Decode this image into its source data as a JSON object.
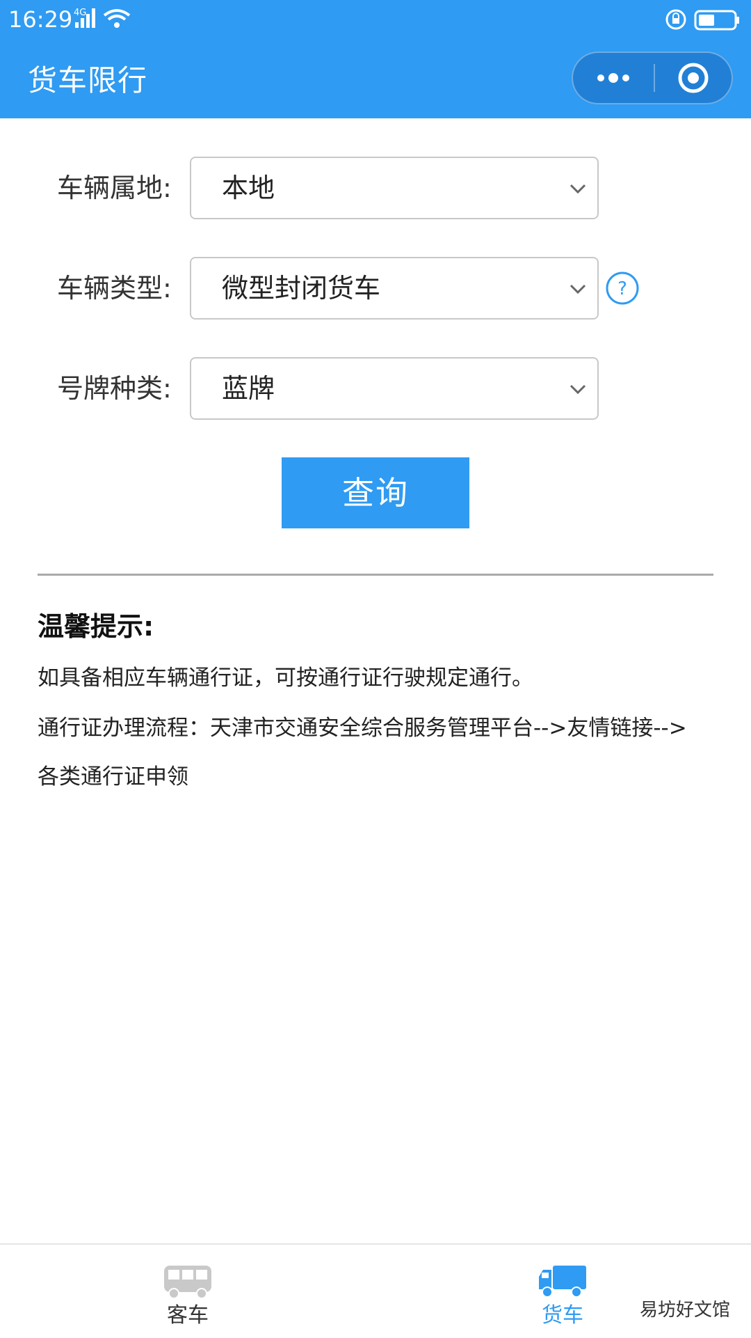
{
  "status_bar": {
    "time": "16:29",
    "network": "4G"
  },
  "header": {
    "title": "货车限行",
    "more_icon": "more-dots-icon",
    "close_icon": "target-close-icon"
  },
  "form": {
    "fields": [
      {
        "label": "车辆属地:",
        "value": "本地"
      },
      {
        "label": "车辆类型:",
        "value": "微型封闭货车",
        "help": "?"
      },
      {
        "label": "号牌种类:",
        "value": "蓝牌"
      }
    ],
    "query_button": "查询"
  },
  "tips": {
    "title": "温馨提示:",
    "lines": [
      "如具备相应车辆通行证，可按通行证行驶规定通行。",
      "通行证办理流程：天津市交通安全综合服务管理平台-->友情链接-->",
      "各类通行证申领"
    ]
  },
  "tabbar": {
    "tabs": [
      {
        "label": "客车",
        "icon": "bus-icon",
        "active": false
      },
      {
        "label": "货车",
        "icon": "truck-icon",
        "active": true
      }
    ]
  },
  "watermark": "易坊好文馆",
  "colors": {
    "primary": "#2f9bf2",
    "inactive_tab": "#c9c9c9"
  }
}
